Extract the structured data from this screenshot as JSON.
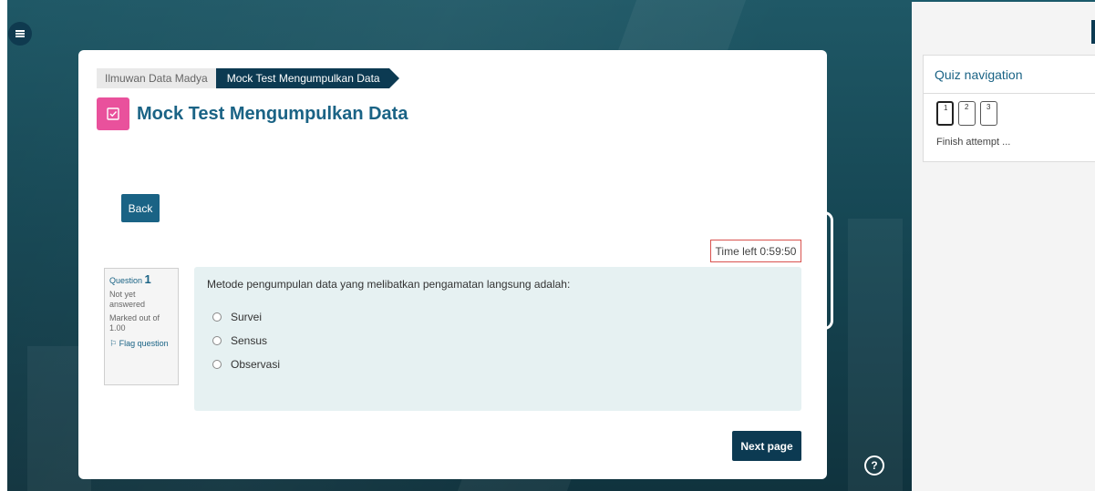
{
  "breadcrumb": {
    "parent": "Ilmuwan Data Madya",
    "current": "Mock Test Mengumpulkan Data"
  },
  "page": {
    "title": "Mock Test Mengumpulkan Data",
    "back_label": "Back",
    "next_label": "Next page",
    "help_label": "?"
  },
  "timer": {
    "text": "Time left 0:59:50"
  },
  "question": {
    "label": "Question",
    "number": "1",
    "state": "Not yet answered",
    "marks": "Marked out of 1.00",
    "flag_label": "Flag question",
    "text": "Metode pengumpulan data yang melibatkan pengamatan langsung adalah:",
    "options": [
      "Survei",
      "Sensus",
      "Observasi"
    ]
  },
  "quiz_nav": {
    "title": "Quiz navigation",
    "buttons": [
      "1",
      "2",
      "3"
    ],
    "finish_label": "Finish attempt ..."
  },
  "colors": {
    "accent": "#1a6385",
    "dark": "#0c3a52",
    "quiz_icon": "#e9519c",
    "timer_border": "#d9534f",
    "question_bg": "#e6f1f2"
  }
}
